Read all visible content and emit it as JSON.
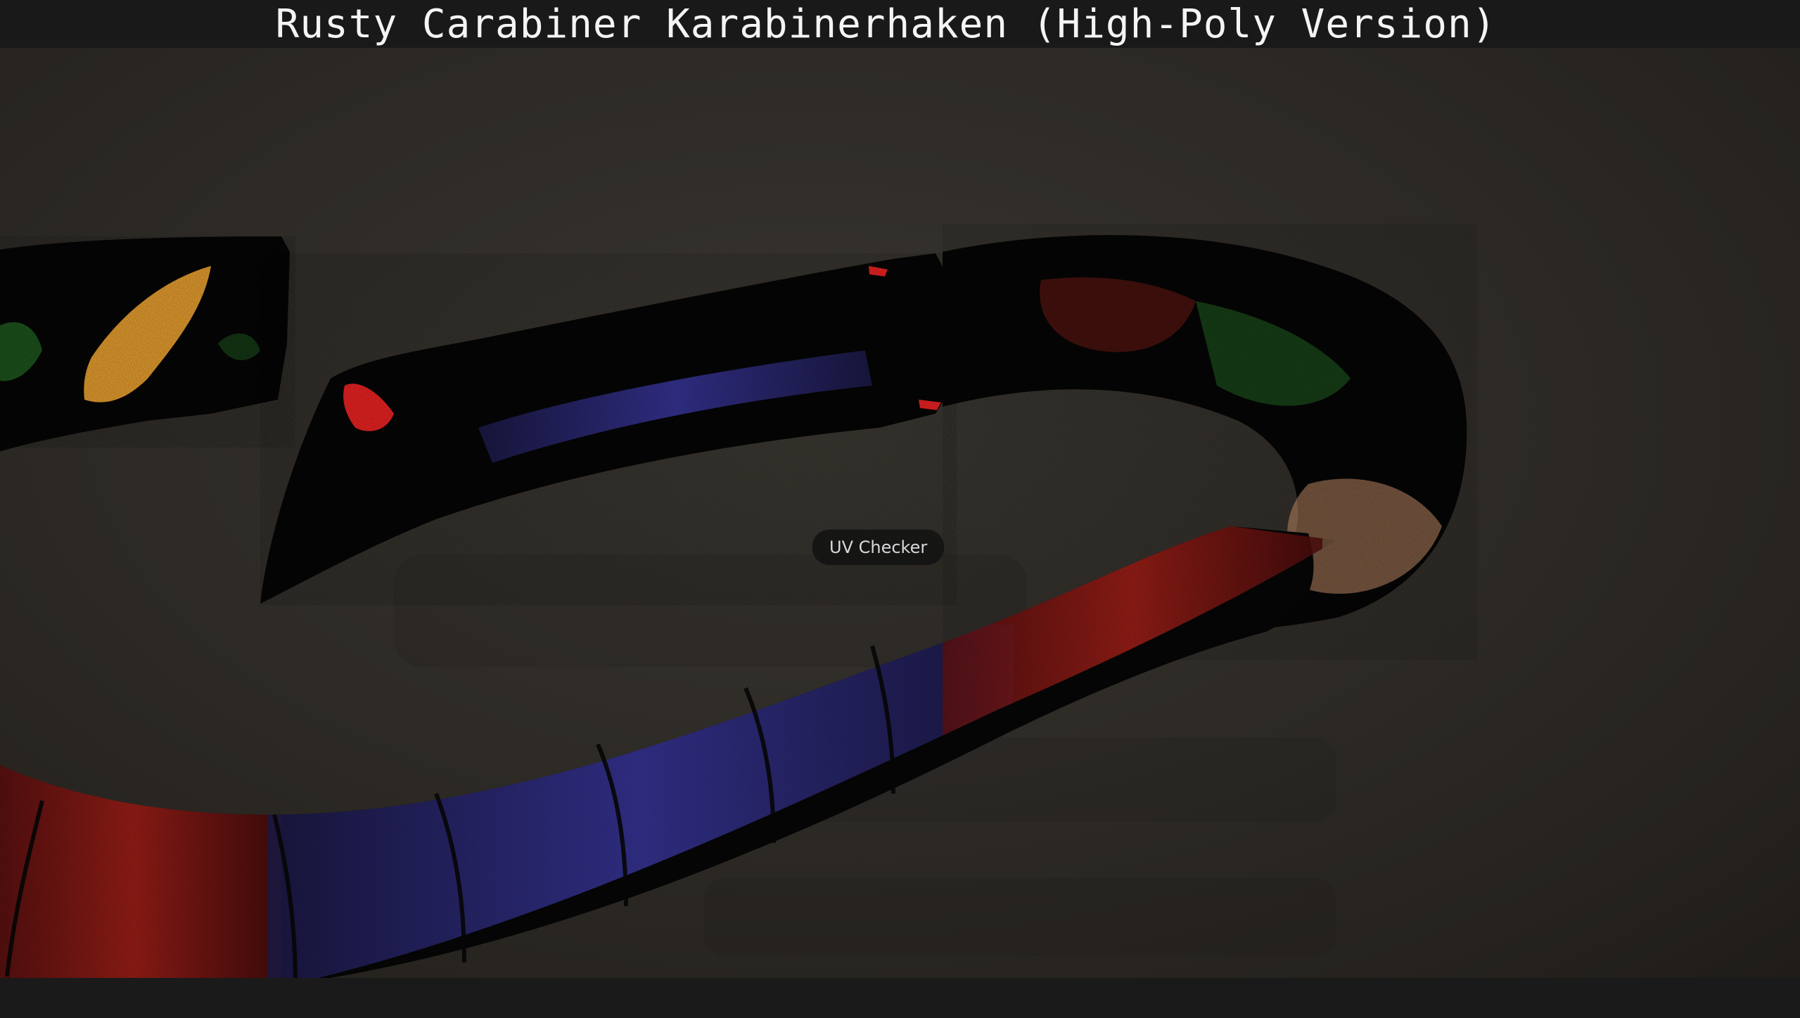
{
  "window": {
    "title": "Rusty Carabiner Karabinerhaken (High-Poly Version)"
  },
  "viewport": {
    "overlay_label": "UV Checker"
  },
  "colors": {
    "background": "#2e2b27",
    "mesh_base": "#050505",
    "uv_blue": "#5a55c8",
    "uv_red": "#c42a22",
    "uv_green": "#2e8a2e",
    "uv_orange": "#e8a030",
    "uv_peach": "#c8906a"
  }
}
